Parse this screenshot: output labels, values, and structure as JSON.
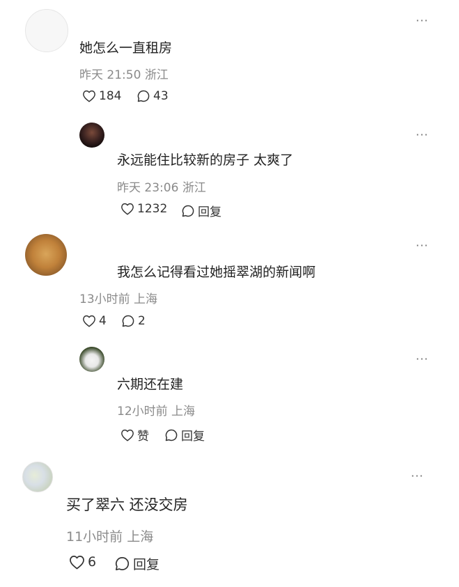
{
  "comments": [
    {
      "text": "她怎么一直租房",
      "time": "昨天 21:50",
      "location": "浙江",
      "likes": "184",
      "replies": "43",
      "more": "···"
    },
    {
      "text": "永远能住比较新的房子 太爽了",
      "time": "昨天 23:06",
      "location": "浙江",
      "likes": "1232",
      "reply_label": "回复",
      "more": "···"
    },
    {
      "text": "我怎么记得看过她摇翠湖的新闻啊",
      "time": "13小时前",
      "location": "上海",
      "likes": "4",
      "replies": "2",
      "more": "···"
    },
    {
      "text": "六期还在建",
      "time": "12小时前",
      "location": "上海",
      "like_label": "赞",
      "reply_label": "回复",
      "more": "···"
    },
    {
      "text": "买了翠六 还没交房",
      "time": "11小时前",
      "location": "上海",
      "likes": "6",
      "reply_label": "回复",
      "more": "···"
    }
  ],
  "colors": {
    "text": "#222222",
    "meta": "#8a8a8a",
    "icon": "#333333"
  }
}
